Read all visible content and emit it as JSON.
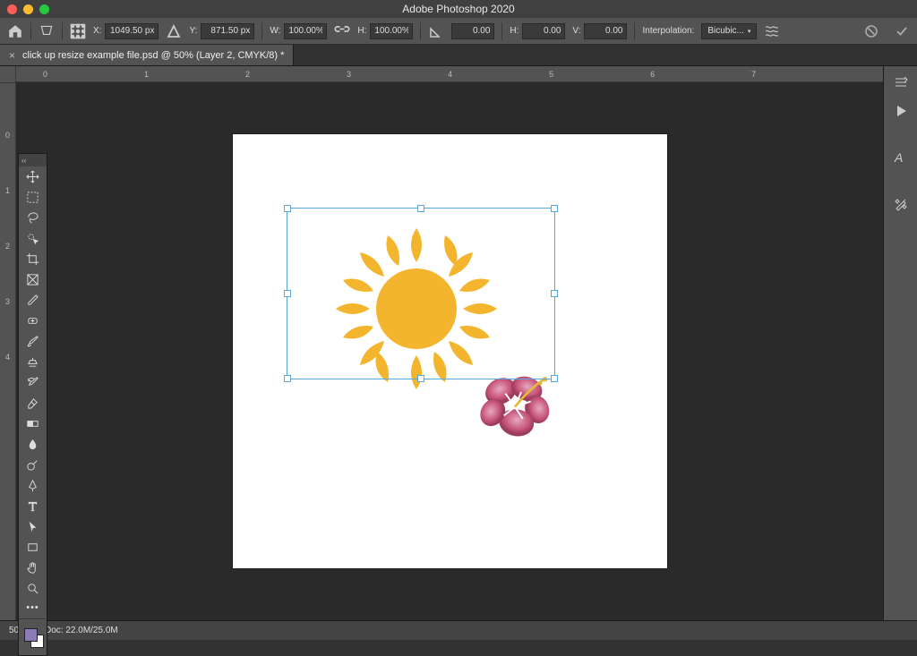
{
  "app": {
    "title": "Adobe Photoshop 2020"
  },
  "optionsbar": {
    "x_label": "X:",
    "x_value": "1049.50 px",
    "y_label": "Y:",
    "y_value": "871.50 px",
    "w_label": "W:",
    "w_value": "100.00%",
    "h_label": "H:",
    "h_value": "100.00%",
    "angle_value": "0.00",
    "skew_h_label": "H:",
    "skew_h_value": "0.00",
    "skew_v_label": "V:",
    "skew_v_value": "0.00",
    "interp_label": "Interpolation:",
    "interp_value": "Bicubic..."
  },
  "tabs": [
    {
      "title": "click up resize example file.psd @ 50% (Layer 2, CMYK/8) *"
    }
  ],
  "status": {
    "zoom": "50%",
    "doc": "Doc: 22.0M/25.0M"
  },
  "ruler": {
    "h": [
      "0",
      "1",
      "2",
      "3",
      "4",
      "5",
      "6",
      "7"
    ],
    "v": [
      "0",
      "1",
      "2",
      "3",
      "4"
    ]
  },
  "tools": [
    "move-tool",
    "marquee-tool",
    "lasso-tool",
    "quick-select-tool",
    "crop-tool",
    "frame-tool",
    "eyedropper-tool",
    "healing-brush-tool",
    "brush-tool",
    "clone-stamp-tool",
    "history-brush-tool",
    "eraser-tool",
    "gradient-tool",
    "blur-tool",
    "dodge-tool",
    "pen-tool",
    "type-tool",
    "path-select-tool",
    "rectangle-tool",
    "hand-tool",
    "zoom-tool",
    "edit-toolbar"
  ],
  "rightpanel": [
    "panel-menu-icon",
    "play-icon",
    "character-panel-icon",
    "tool-presets-icon",
    "brush-settings-icon"
  ],
  "artwork": {
    "sun_color": "#f4b52e",
    "flower_primary": "#c7567a",
    "flower_light": "#dda0bb"
  }
}
